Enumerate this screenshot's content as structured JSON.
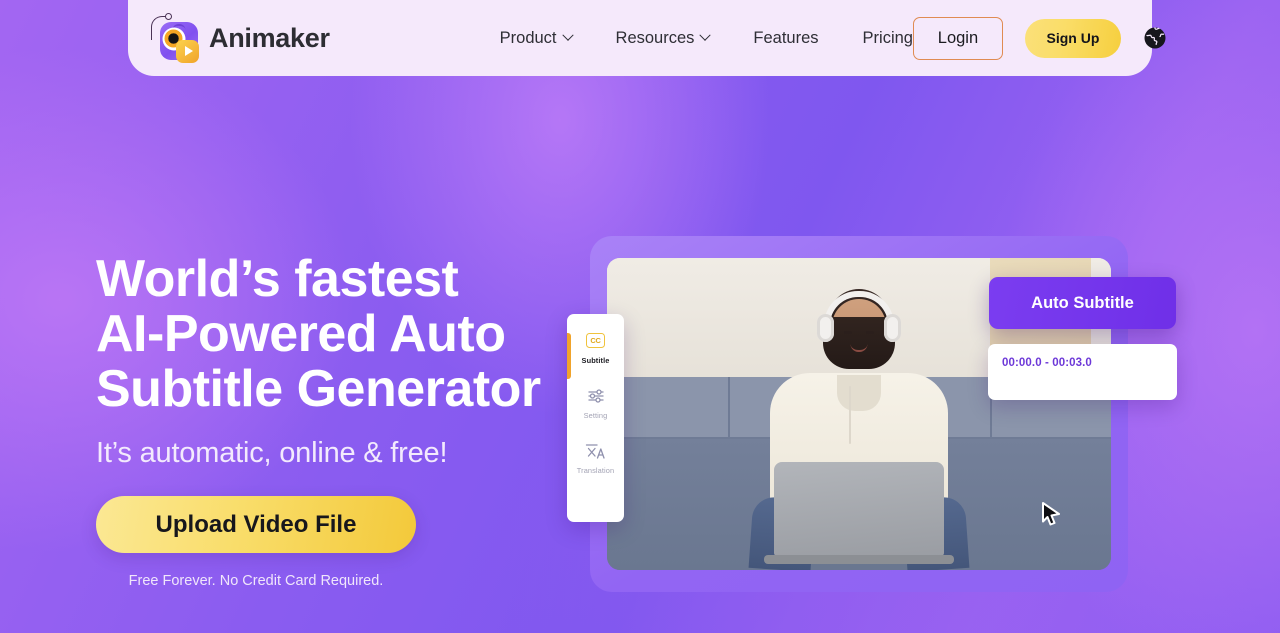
{
  "header": {
    "logo": {
      "name": "Animaker",
      "icon": "animaker-logo-icon"
    },
    "nav": [
      {
        "label": "Product",
        "has_dropdown": true,
        "icon": "chevron-down-icon"
      },
      {
        "label": "Resources",
        "has_dropdown": true,
        "icon": "chevron-down-icon"
      },
      {
        "label": "Features",
        "has_dropdown": false
      },
      {
        "label": "Pricing",
        "has_dropdown": false
      }
    ],
    "login_label": "Login",
    "signup_label": "Sign Up",
    "language_icon": "globe-icon"
  },
  "hero": {
    "title_lines": [
      "World’s fastest",
      "AI-Powered Auto",
      "Subtitle Generator"
    ],
    "subtitle": "It’s automatic, online & free!",
    "cta_label": "Upload Video File",
    "disclaimer": "Free Forever. No Credit Card Required."
  },
  "mockup": {
    "auto_subtitle_label": "Auto Subtitle",
    "subtitle_timecode": "00:00.0 - 00:03.0",
    "cursor_icon": "mouse-pointer-icon",
    "tools": [
      {
        "label": "Subtitle",
        "icon": "closed-caption-icon",
        "active": true
      },
      {
        "label": "Setting",
        "icon": "sliders-icon",
        "active": false
      },
      {
        "label": "Translation",
        "icon": "translate-icon",
        "active": false
      }
    ]
  },
  "colors": {
    "page_purple": "#8a5cf0",
    "header_bg": "#f5e9fb",
    "accent_yellow": "#f6cf3e",
    "login_border": "#e08b52",
    "card_purple": "#7b3df0",
    "timecode_purple": "#6d38d8",
    "active_tool_orange": "#f0a32b"
  }
}
